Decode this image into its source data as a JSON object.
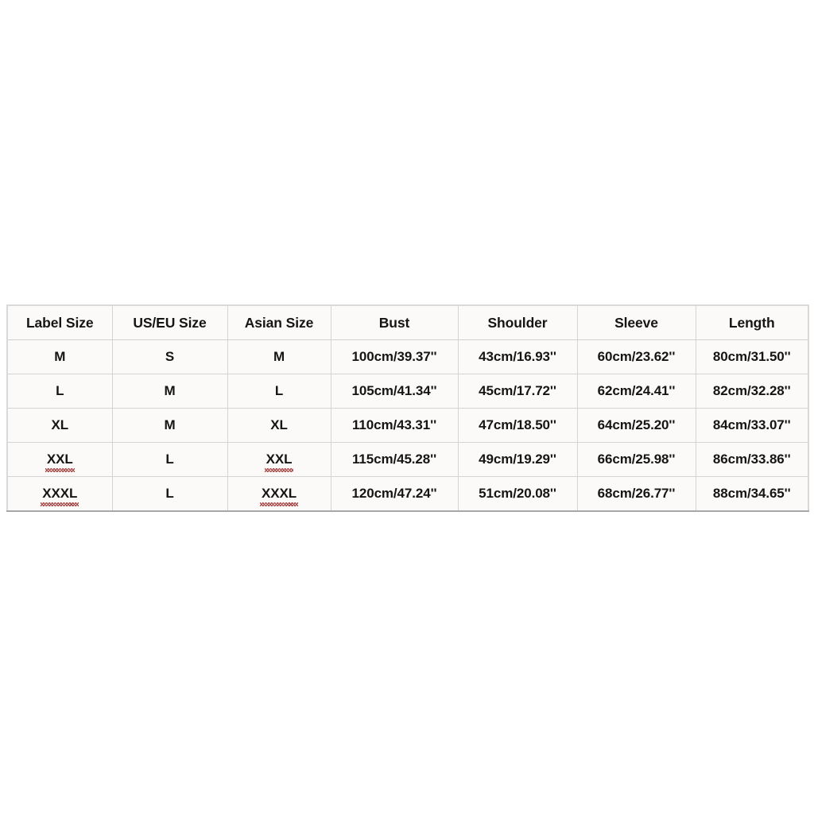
{
  "page": {
    "background_color": "#ffffff",
    "table_border_color": "#d4d4d4",
    "cell_background": "#fbfaf8",
    "text_color": "#151515",
    "spellcheck_underline_color": "#a33a3a"
  },
  "size_chart": {
    "name": "clothing-size-chart",
    "columns": [
      "Label Size",
      "US/EU Size",
      "Asian Size",
      "Bust",
      "Shoulder",
      "Sleeve",
      "Length"
    ],
    "rows": [
      {
        "label_size": "M",
        "us_eu_size": "S",
        "asian_size": "M",
        "bust": "100cm/39.37''",
        "shoulder": "43cm/16.93''",
        "sleeve": "60cm/23.62''",
        "length": "80cm/31.50''",
        "label_size_misspelled": false,
        "asian_size_misspelled": false
      },
      {
        "label_size": "L",
        "us_eu_size": "M",
        "asian_size": "L",
        "bust": "105cm/41.34''",
        "shoulder": "45cm/17.72''",
        "sleeve": "62cm/24.41''",
        "length": "82cm/32.28''",
        "label_size_misspelled": false,
        "asian_size_misspelled": false
      },
      {
        "label_size": "XL",
        "us_eu_size": "M",
        "asian_size": "XL",
        "bust": "110cm/43.31''",
        "shoulder": "47cm/18.50''",
        "sleeve": "64cm/25.20''",
        "length": "84cm/33.07''",
        "label_size_misspelled": false,
        "asian_size_misspelled": false
      },
      {
        "label_size": "XXL",
        "us_eu_size": "L",
        "asian_size": "XXL",
        "bust": "115cm/45.28''",
        "shoulder": "49cm/19.29''",
        "sleeve": "66cm/25.98''",
        "length": "86cm/33.86''",
        "label_size_misspelled": true,
        "asian_size_misspelled": true
      },
      {
        "label_size": "XXXL",
        "us_eu_size": "L",
        "asian_size": "XXXL",
        "bust": "120cm/47.24''",
        "shoulder": "51cm/20.08''",
        "sleeve": "68cm/26.77''",
        "length": "88cm/34.65''",
        "label_size_misspelled": true,
        "asian_size_misspelled": true
      }
    ]
  }
}
